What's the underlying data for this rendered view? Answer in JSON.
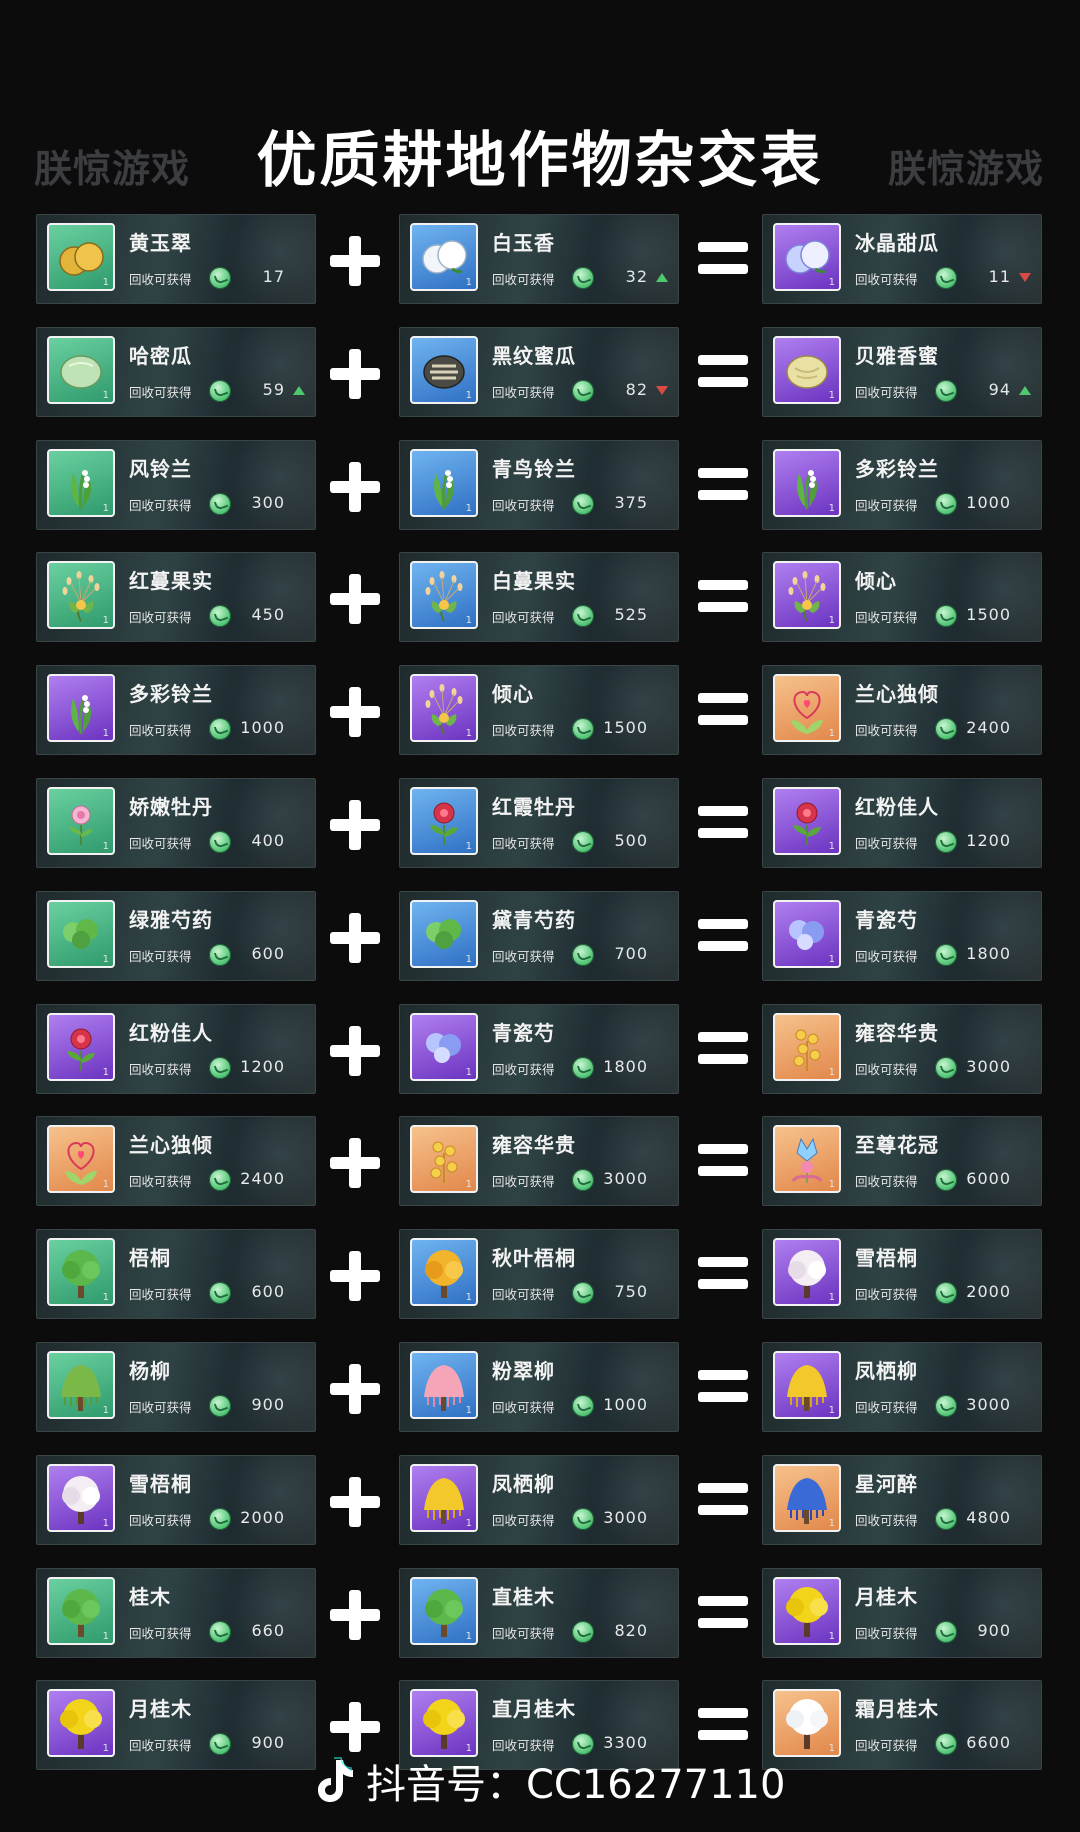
{
  "header": {
    "title": "优质耕地作物杂交表",
    "watermark_left": "朕惊游戏",
    "watermark_right": "朕惊游戏"
  },
  "reward_label": "回收可获得",
  "tile_level": "1",
  "colors": {
    "green": "#3fae7e",
    "blue": "#3d88d6",
    "purple": "#8e4fd6",
    "orange": "#e98b44",
    "trend_up": "#4ccb6a",
    "trend_down": "#e0453e"
  },
  "rows": [
    {
      "a": {
        "name": "黄玉翠",
        "value": "17",
        "tile": "green",
        "icon": "yellow-melon-icon",
        "trend": ""
      },
      "b": {
        "name": "白玉香",
        "value": "32",
        "tile": "blue",
        "icon": "white-melon-icon",
        "trend": "up"
      },
      "c": {
        "name": "冰晶甜瓜",
        "value": "11",
        "tile": "purple",
        "icon": "ice-melon-icon",
        "trend": "down"
      }
    },
    {
      "a": {
        "name": "哈密瓜",
        "value": "59",
        "tile": "green",
        "icon": "hami-melon-icon",
        "trend": "up"
      },
      "b": {
        "name": "黑纹蜜瓜",
        "value": "82",
        "tile": "blue",
        "icon": "striped-melon-icon",
        "trend": "down"
      },
      "c": {
        "name": "贝雅香蜜",
        "value": "94",
        "tile": "purple",
        "icon": "honeydew-icon",
        "trend": "up"
      }
    },
    {
      "a": {
        "name": "风铃兰",
        "value": "300",
        "tile": "green",
        "icon": "lily-of-valley-icon",
        "trend": ""
      },
      "b": {
        "name": "青鸟铃兰",
        "value": "375",
        "tile": "blue",
        "icon": "lily-of-valley-icon",
        "trend": ""
      },
      "c": {
        "name": "多彩铃兰",
        "value": "1000",
        "tile": "purple",
        "icon": "lily-of-valley-icon",
        "trend": ""
      }
    },
    {
      "a": {
        "name": "红蔓果实",
        "value": "450",
        "tile": "green",
        "icon": "vine-fruit-icon",
        "trend": ""
      },
      "b": {
        "name": "白蔓果实",
        "value": "525",
        "tile": "blue",
        "icon": "vine-fruit-icon",
        "trend": ""
      },
      "c": {
        "name": "倾心",
        "value": "1500",
        "tile": "purple",
        "icon": "vine-fruit-icon",
        "trend": ""
      }
    },
    {
      "a": {
        "name": "多彩铃兰",
        "value": "1000",
        "tile": "purple",
        "icon": "lily-of-valley-icon",
        "trend": ""
      },
      "b": {
        "name": "倾心",
        "value": "1500",
        "tile": "purple",
        "icon": "vine-fruit-icon",
        "trend": ""
      },
      "c": {
        "name": "兰心独倾",
        "value": "2400",
        "tile": "orange",
        "icon": "heart-flower-icon",
        "trend": ""
      }
    },
    {
      "a": {
        "name": "娇嫩牡丹",
        "value": "400",
        "tile": "green",
        "icon": "peony-icon",
        "trend": ""
      },
      "b": {
        "name": "红霞牡丹",
        "value": "500",
        "tile": "blue",
        "icon": "red-peony-icon",
        "trend": ""
      },
      "c": {
        "name": "红粉佳人",
        "value": "1200",
        "tile": "purple",
        "icon": "red-peony-icon",
        "trend": ""
      }
    },
    {
      "a": {
        "name": "绿雅芍药",
        "value": "600",
        "tile": "green",
        "icon": "green-peony-icon",
        "trend": ""
      },
      "b": {
        "name": "黛青芍药",
        "value": "700",
        "tile": "blue",
        "icon": "green-peony-icon",
        "trend": ""
      },
      "c": {
        "name": "青瓷芍",
        "value": "1800",
        "tile": "purple",
        "icon": "blue-peony-icon",
        "trend": ""
      }
    },
    {
      "a": {
        "name": "红粉佳人",
        "value": "1200",
        "tile": "purple",
        "icon": "red-peony-icon",
        "trend": ""
      },
      "b": {
        "name": "青瓷芍",
        "value": "1800",
        "tile": "purple",
        "icon": "blue-peony-icon",
        "trend": ""
      },
      "c": {
        "name": "雍容华贵",
        "value": "3000",
        "tile": "orange",
        "icon": "golden-flower-icon",
        "trend": ""
      }
    },
    {
      "a": {
        "name": "兰心独倾",
        "value": "2400",
        "tile": "orange",
        "icon": "heart-flower-icon",
        "trend": ""
      },
      "b": {
        "name": "雍容华贵",
        "value": "3000",
        "tile": "orange",
        "icon": "golden-flower-icon",
        "trend": ""
      },
      "c": {
        "name": "至尊花冠",
        "value": "6000",
        "tile": "orange",
        "icon": "crown-flower-icon",
        "trend": ""
      }
    },
    {
      "a": {
        "name": "梧桐",
        "value": "600",
        "tile": "green",
        "icon": "green-tree-icon",
        "trend": ""
      },
      "b": {
        "name": "秋叶梧桐",
        "value": "750",
        "tile": "blue",
        "icon": "autumn-tree-icon",
        "trend": ""
      },
      "c": {
        "name": "雪梧桐",
        "value": "2000",
        "tile": "purple",
        "icon": "snow-tree-icon",
        "trend": ""
      }
    },
    {
      "a": {
        "name": "杨柳",
        "value": "900",
        "tile": "green",
        "icon": "willow-icon",
        "trend": ""
      },
      "b": {
        "name": "粉翠柳",
        "value": "1000",
        "tile": "blue",
        "icon": "pink-willow-icon",
        "trend": ""
      },
      "c": {
        "name": "凤栖柳",
        "value": "3000",
        "tile": "purple",
        "icon": "golden-willow-icon",
        "trend": ""
      }
    },
    {
      "a": {
        "name": "雪梧桐",
        "value": "2000",
        "tile": "purple",
        "icon": "snow-tree-icon",
        "trend": ""
      },
      "b": {
        "name": "凤栖柳",
        "value": "3000",
        "tile": "purple",
        "icon": "golden-willow-icon",
        "trend": ""
      },
      "c": {
        "name": "星河醉",
        "value": "4800",
        "tile": "orange",
        "icon": "blue-willow-icon",
        "trend": ""
      }
    },
    {
      "a": {
        "name": "桂木",
        "value": "660",
        "tile": "green",
        "icon": "green-tree-icon",
        "trend": ""
      },
      "b": {
        "name": "直桂木",
        "value": "820",
        "tile": "blue",
        "icon": "green-tree-icon",
        "trend": ""
      },
      "c": {
        "name": "月桂木",
        "value": "900",
        "tile": "purple",
        "icon": "yellow-tree-icon",
        "trend": ""
      }
    },
    {
      "a": {
        "name": "月桂木",
        "value": "900",
        "tile": "purple",
        "icon": "yellow-tree-icon",
        "trend": ""
      },
      "b": {
        "name": "直月桂木",
        "value": "3300",
        "tile": "purple",
        "icon": "yellow-tree-icon",
        "trend": ""
      },
      "c": {
        "name": "霜月桂木",
        "value": "6600",
        "tile": "orange",
        "icon": "frost-tree-icon",
        "trend": ""
      }
    }
  ],
  "footer": {
    "icon": "tiktok-icon",
    "text": "抖音号：CC16277110"
  }
}
